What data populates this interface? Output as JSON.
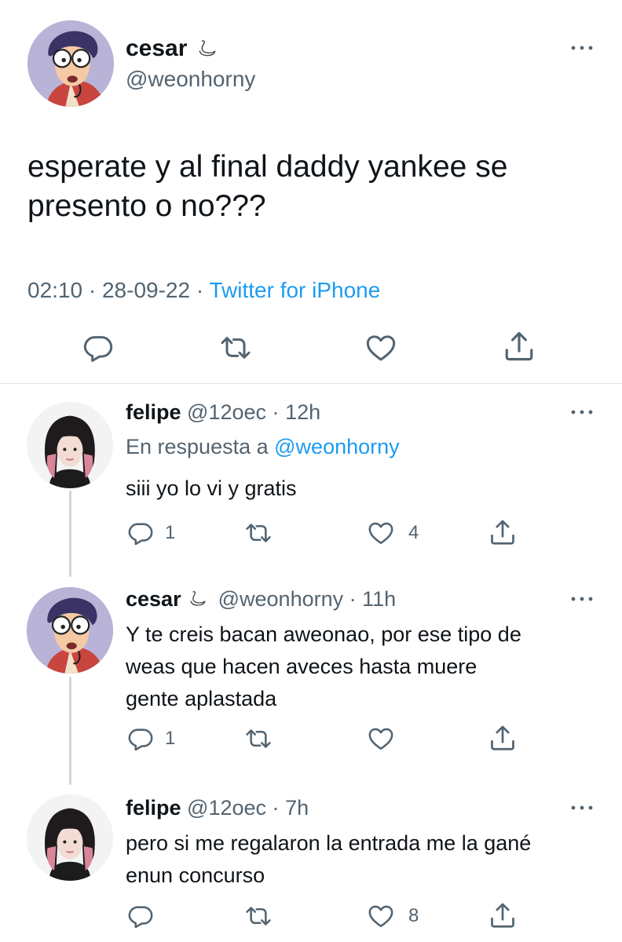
{
  "main_tweet": {
    "display_name": "cesar",
    "badge_emoji": "🦢",
    "handle": "@weonhorny",
    "text_line1": "esperate y al final daddy yankee se",
    "text_line2": "presento o no???",
    "time": "02:10",
    "sep1": "·",
    "date": "28-09-22",
    "sep2": "·",
    "source": "Twitter for iPhone"
  },
  "replies": [
    {
      "display_name": "felipe",
      "handle": "@12oec",
      "sep": "·",
      "age": "12h",
      "reply_prefix": "En respuesta a",
      "reply_to": "@weonhorny",
      "lines": [
        "siii yo lo vi y gratis"
      ],
      "reply_count": "1",
      "like_count": "4"
    },
    {
      "display_name": "cesar",
      "badge_emoji": "🦢",
      "handle": "@weonhorny",
      "sep": "·",
      "age": "11h",
      "lines": [
        "Y te creis bacan aweonao, por ese tipo de",
        "weas que hacen aveces hasta muere",
        "gente aplastada"
      ],
      "reply_count": "1",
      "like_count": ""
    },
    {
      "display_name": "felipe",
      "handle": "@12oec",
      "sep": "·",
      "age": "7h",
      "lines": [
        "pero si me regalaron la entrada me la gané",
        "enun concurso"
      ],
      "reply_count": "",
      "like_count": "8"
    }
  ],
  "colors": {
    "text": "#0f1419",
    "secondary": "#536471",
    "accent": "#1d9bf0",
    "divider": "#e1e5e8"
  }
}
